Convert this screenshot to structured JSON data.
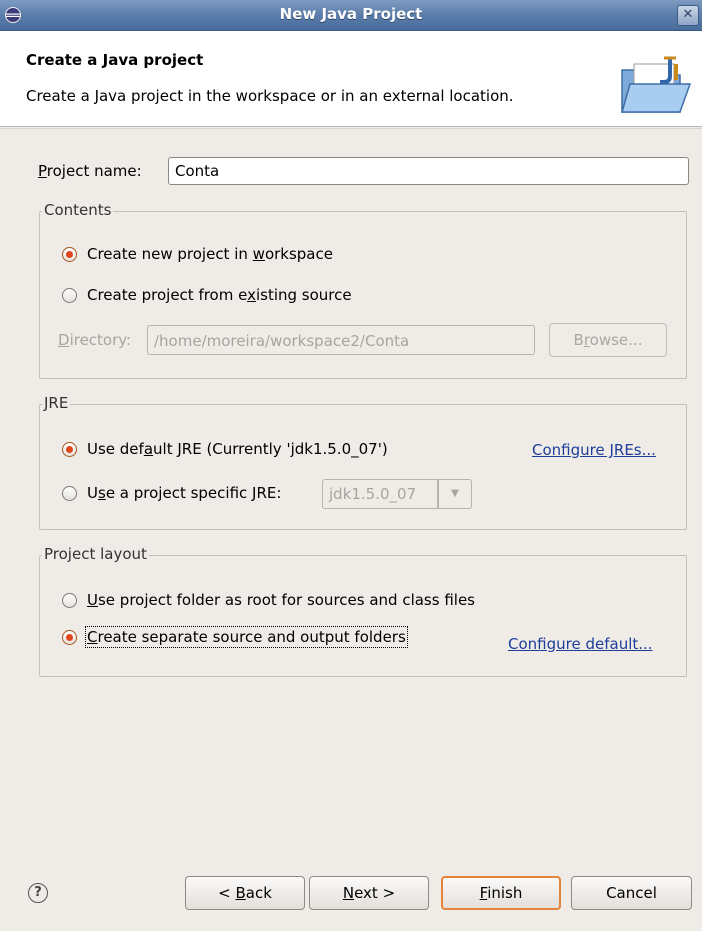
{
  "window": {
    "title": "New Java Project",
    "close_glyph": "✕"
  },
  "banner": {
    "heading": "Create a Java project",
    "description": "Create a Java project in the workspace or in an external location."
  },
  "project_name": {
    "label_first": "P",
    "label_rest": "roject name:",
    "value": "Conta"
  },
  "contents": {
    "legend": "Contents",
    "opt_new": {
      "pre": "Create new project in ",
      "mn": "w",
      "post": "orkspace",
      "selected": true
    },
    "opt_existing": {
      "pre": "Create project from e",
      "mn": "x",
      "post": "isting source",
      "selected": false
    },
    "directory_label_first": "D",
    "directory_label_rest": "irectory:",
    "directory_value": "/home/moreira/workspace2/Conta",
    "browse_pre": "B",
    "browse_mn": "r",
    "browse_post": "owse..."
  },
  "jre": {
    "legend": "JRE",
    "opt_default": {
      "pre": "Use def",
      "mn": "a",
      "post": "ult JRE (Currently 'jdk1.5.0_07')",
      "selected": true
    },
    "opt_specific": {
      "pre": "U",
      "mn": "s",
      "post": "e a project specific JRE:",
      "selected": false
    },
    "configure_link": "Configure JREs...",
    "combo_value": "jdk1.5.0_07",
    "combo_arrow": "▼"
  },
  "layout": {
    "legend": "Project layout",
    "opt_root": {
      "mn": "U",
      "post": "se project folder as root for sources and class files",
      "selected": false
    },
    "opt_separate": {
      "mn": "C",
      "post": "reate separate source and output folders",
      "selected": true
    },
    "configure_link": "Configure default..."
  },
  "buttons": {
    "help": "?",
    "back_pre": "< ",
    "back_mn": "B",
    "back_post": "ack",
    "next_mn": "N",
    "next_post": "ext >",
    "finish_mn": "F",
    "finish_post": "inish",
    "cancel": "Cancel"
  }
}
